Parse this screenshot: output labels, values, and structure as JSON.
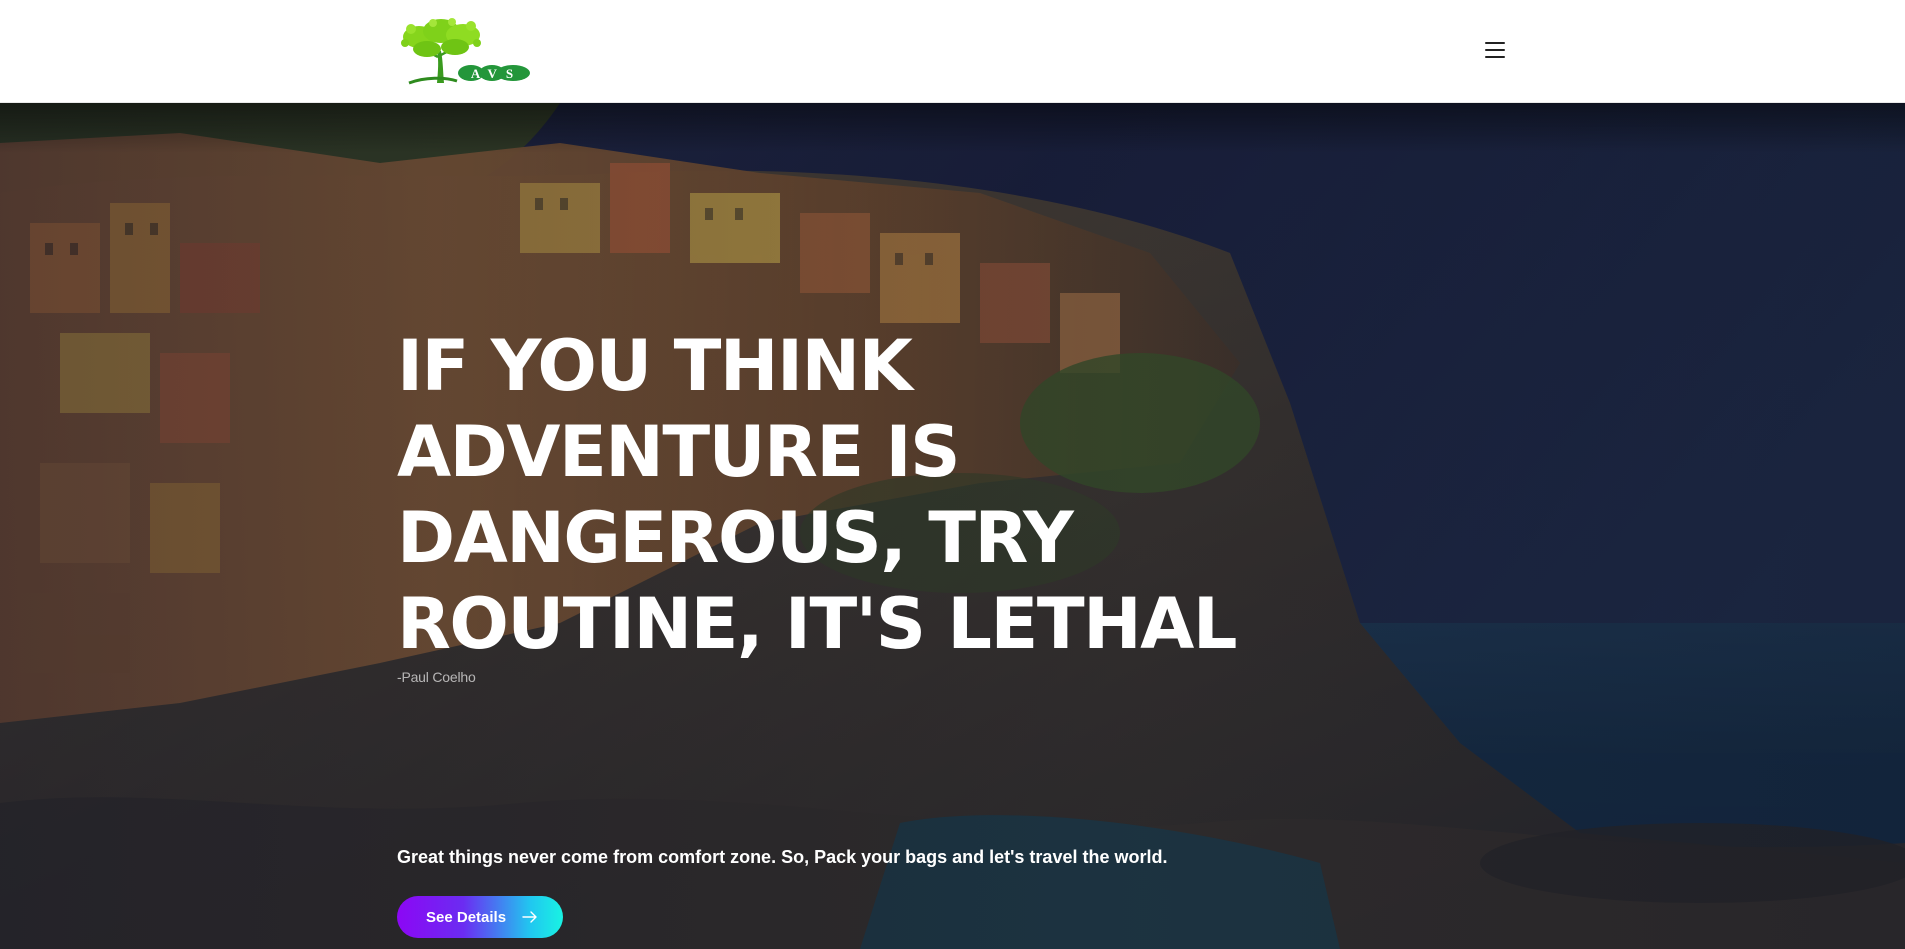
{
  "header": {
    "logo_text": "AVS",
    "menu_icon": "hamburger-menu-icon"
  },
  "hero": {
    "title": "IF YOU THINK ADVENTURE IS DANGEROUS, TRY ROUTINE, IT'S LETHAL",
    "author": "-Paul Coelho",
    "subtitle": "Great things never come from comfort zone. So, Pack your bags and let's travel the world.",
    "cta_label": "See Details",
    "cta_icon": "arrow-right-icon"
  },
  "colors": {
    "header_bg": "#ffffff",
    "logo_green": "#7fd11a",
    "logo_dark_green": "#2e8b1e",
    "cta_gradient_start": "#8c07f4",
    "cta_gradient_end": "#19f3e3",
    "hero_text": "#ffffff"
  }
}
